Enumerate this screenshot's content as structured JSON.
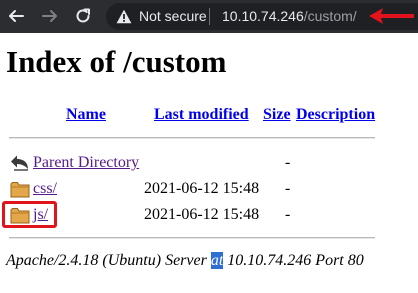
{
  "browser": {
    "security_label": "Not secure",
    "url_host": "10.10.74.246",
    "url_path": "/custom/",
    "icons": {
      "back": "back-arrow-icon",
      "forward": "forward-arrow-icon",
      "reload": "reload-icon",
      "security": "warning-triangle-icon"
    },
    "annotation_color": "#e0141a"
  },
  "page": {
    "title": "Index of /custom",
    "headers": {
      "name": "Name",
      "last_modified": "Last modified",
      "size": "Size",
      "description": "Description"
    },
    "rows": [
      {
        "icon": "back-folder-icon",
        "name": "Parent Directory",
        "last_modified": "",
        "size": "-"
      },
      {
        "icon": "folder-icon",
        "name": "css/",
        "last_modified": "2021-06-12 15:48",
        "size": "-"
      },
      {
        "icon": "folder-icon",
        "name": "js/",
        "last_modified": "2021-06-12 15:48",
        "size": "-",
        "highlighted": true
      }
    ],
    "footer": {
      "before": "Apache/2.4.18 (Ubuntu) Server ",
      "selected": "at",
      "after": " 10.10.74.246 Port 80"
    },
    "colors": {
      "link": "#0000ee",
      "visited_link": "#551a8b",
      "selection": "#2f6fd3"
    }
  }
}
